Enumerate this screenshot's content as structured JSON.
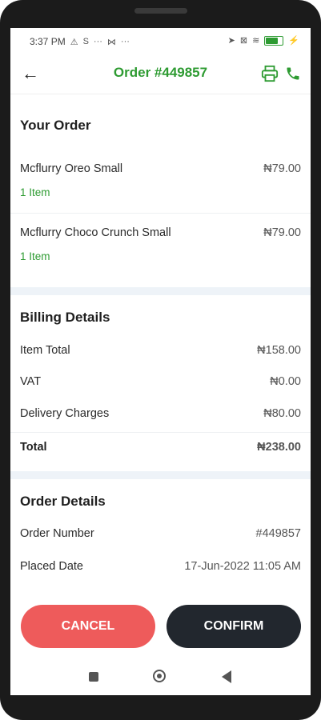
{
  "status_bar": {
    "time": "3:37 PM",
    "left_glyphs": [
      "⚠",
      "S",
      "···",
      "⋈",
      "···"
    ],
    "right_glyphs": [
      "➤",
      "⊠",
      "≋"
    ]
  },
  "header": {
    "title": "Order #449857",
    "colors": {
      "accent": "#2e9b32"
    },
    "icons": [
      "back-arrow-icon",
      "printer-icon",
      "phone-icon"
    ]
  },
  "your_order": {
    "title": "Your Order",
    "items": [
      {
        "name": "Mcflurry Oreo Small",
        "price": "₦79.00",
        "qty": "1  Item"
      },
      {
        "name": "Mcflurry Choco Crunch Small",
        "price": "₦79.00",
        "qty": "1  Item"
      }
    ]
  },
  "billing": {
    "title": "Billing Details",
    "rows": [
      {
        "label": "Item Total",
        "value": "₦158.00"
      },
      {
        "label": "VAT",
        "value": "₦0.00"
      },
      {
        "label": "Delivery Charges",
        "value": "₦80.00"
      }
    ],
    "total": {
      "label": "Total",
      "value": "₦238.00"
    }
  },
  "order_details": {
    "title": "Order Details",
    "rows": [
      {
        "label": "Order Number",
        "value": "#449857"
      },
      {
        "label": "Placed Date",
        "value": "17-Jun-2022 11:05 AM"
      }
    ]
  },
  "actions": {
    "cancel_label": "CANCEL",
    "confirm_label": "CONFIRM",
    "colors": {
      "cancel": "#ee5b5b",
      "confirm": "#22272e"
    }
  }
}
